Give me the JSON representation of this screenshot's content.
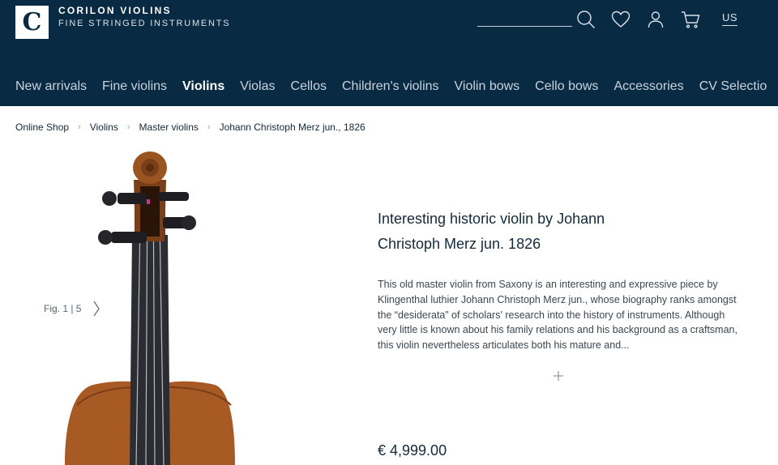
{
  "header": {
    "logo_letter": "C",
    "brand_name": "CORILON VIOLINS",
    "brand_tagline": "FINE STRINGED INSTRUMENTS",
    "search_placeholder": "",
    "country": "US",
    "icons": [
      "search-icon",
      "heart-icon",
      "user-icon",
      "cart-icon"
    ],
    "background_color": "#092a43"
  },
  "nav": {
    "items": [
      {
        "label": "New arrivals",
        "active": false
      },
      {
        "label": "Fine violins",
        "active": false
      },
      {
        "label": "Violins",
        "active": true
      },
      {
        "label": "Violas",
        "active": false
      },
      {
        "label": "Cellos",
        "active": false
      },
      {
        "label": "Children's violins",
        "active": false
      },
      {
        "label": "Violin bows",
        "active": false
      },
      {
        "label": "Cello bows",
        "active": false
      },
      {
        "label": "Accessories",
        "active": false
      },
      {
        "label": "CV Selectio",
        "active": false
      }
    ]
  },
  "breadcrumb": {
    "items": [
      "Online Shop",
      "Violins",
      "Master violins"
    ],
    "current": "Johann Christoph Merz jun., 1826"
  },
  "gallery": {
    "fig_label": "Fig. 1 | 5",
    "current": 1,
    "total": 5
  },
  "product": {
    "title_line1": "Interesting historic violin by Johann",
    "title_line2": "Christoph Merz jun. 1826",
    "description": "This old master violin from Saxony is an interesting and expressive piece by Klingenthal luthier Johann Christoph Merz jun., whose biography ranks amongst the “desiderata” of scholars' research into the history of instruments. Although very little is known about his family relations and his background as a craftsman, this violin nevertheless articulates both his mature and...",
    "expand_symbol": "+",
    "price": "€ 4,999.00"
  }
}
